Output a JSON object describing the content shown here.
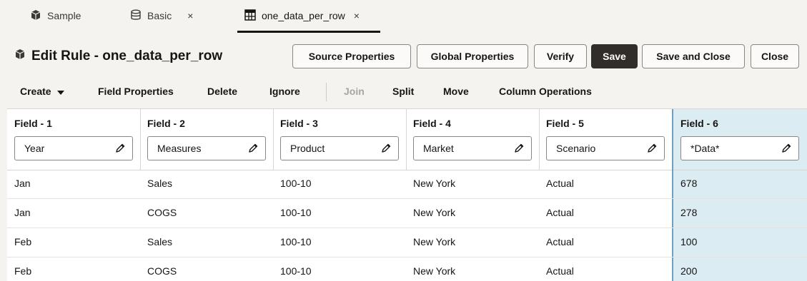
{
  "tabs": [
    {
      "label": "Sample",
      "icon": "cube-icon",
      "closable": false
    },
    {
      "label": "Basic",
      "icon": "database-icon",
      "closable": true
    },
    {
      "label": "one_data_per_row",
      "icon": "grid-icon",
      "closable": true,
      "active": true
    }
  ],
  "close_glyph": "×",
  "header": {
    "title": "Edit Rule - one_data_per_row",
    "buttons": {
      "source_properties": "Source Properties",
      "global_properties": "Global Properties",
      "verify": "Verify",
      "save": "Save",
      "save_and_close": "Save and Close",
      "close": "Close"
    }
  },
  "toolbar": {
    "create": "Create",
    "field_properties": "Field Properties",
    "delete": "Delete",
    "ignore": "Ignore",
    "join": "Join",
    "split": "Split",
    "move": "Move",
    "column_operations": "Column Operations"
  },
  "grid": {
    "columns": [
      {
        "label": "Field - 1",
        "value": "Year"
      },
      {
        "label": "Field - 2",
        "value": "Measures"
      },
      {
        "label": "Field - 3",
        "value": "Product"
      },
      {
        "label": "Field - 4",
        "value": "Market"
      },
      {
        "label": "Field - 5",
        "value": "Scenario"
      },
      {
        "label": "Field - 6",
        "value": "*Data*",
        "selected": true
      }
    ],
    "rows": [
      [
        "Jan",
        "Sales",
        "100-10",
        "New York",
        "Actual",
        "678"
      ],
      [
        "Jan",
        "COGS",
        "100-10",
        "New York",
        "Actual",
        "278"
      ],
      [
        "Feb",
        "Sales",
        "100-10",
        "New York",
        "Actual",
        "100"
      ],
      [
        "Feb",
        "COGS",
        "100-10",
        "New York",
        "Actual",
        "200"
      ]
    ]
  },
  "colors": {
    "primary_button": "#312d2a",
    "selected_column": "#dbecf3",
    "selected_border": "#6e9fbc"
  }
}
